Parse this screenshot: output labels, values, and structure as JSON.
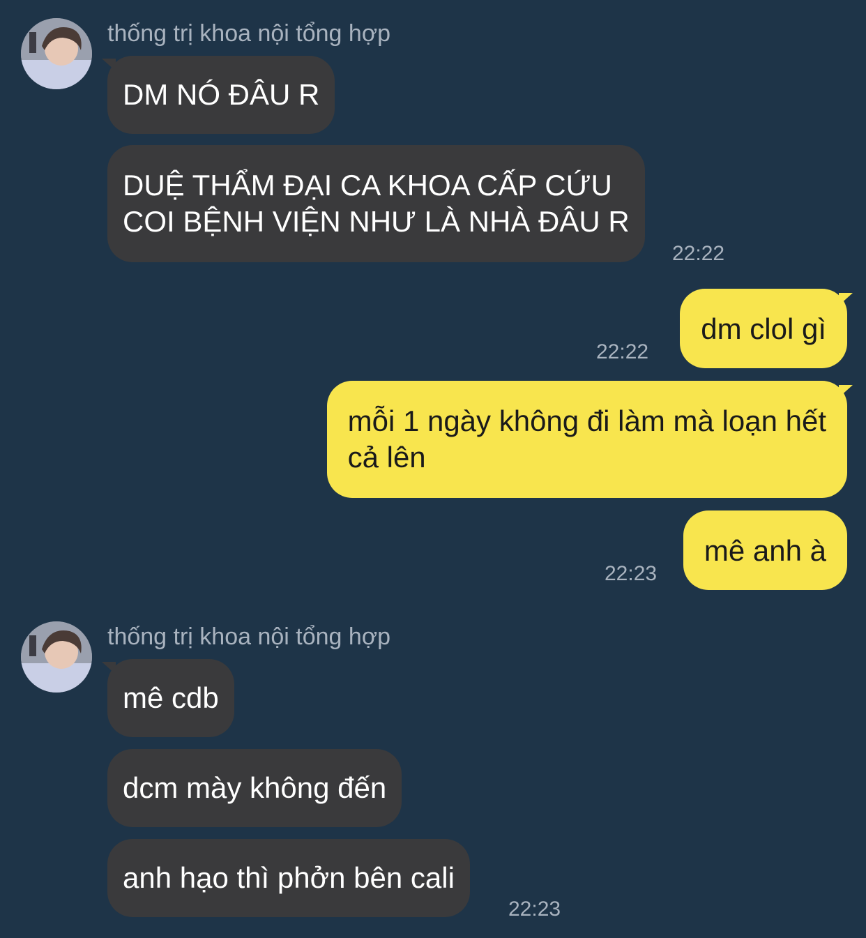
{
  "groups": [
    {
      "sender": "thống trị khoa nội tổng hợp",
      "avatar": "contact-avatar",
      "messages": [
        {
          "text": "DM NÓ ĐÂU R"
        },
        {
          "lines": [
            "DUỆ THẨM ĐẠI CA KHOA CẤP CỨU",
            "COI BỆNH VIỆN NHƯ LÀ NHÀ ĐÂU R"
          ],
          "time": "22:22"
        }
      ]
    },
    {
      "outgoing": true,
      "messages": [
        {
          "text": "dm clol gì",
          "time": "22:22"
        },
        {
          "lines": [
            "mỗi 1 ngày không đi làm mà loạn hết",
            "cả lên"
          ]
        },
        {
          "text": "mê anh à",
          "time": "22:23"
        }
      ]
    },
    {
      "sender": "thống trị khoa nội tổng hợp",
      "avatar": "contact-avatar",
      "messages": [
        {
          "text": "mê cdb"
        },
        {
          "text": "dcm mày không đến"
        },
        {
          "text": "anh hạo thì phởn bên cali",
          "time": "22:23"
        }
      ]
    }
  ],
  "colors": {
    "background": "#1e3448",
    "incoming_bubble": "#3a3a3c",
    "outgoing_bubble": "#f8e54e",
    "meta_text": "#a9b3bf"
  }
}
